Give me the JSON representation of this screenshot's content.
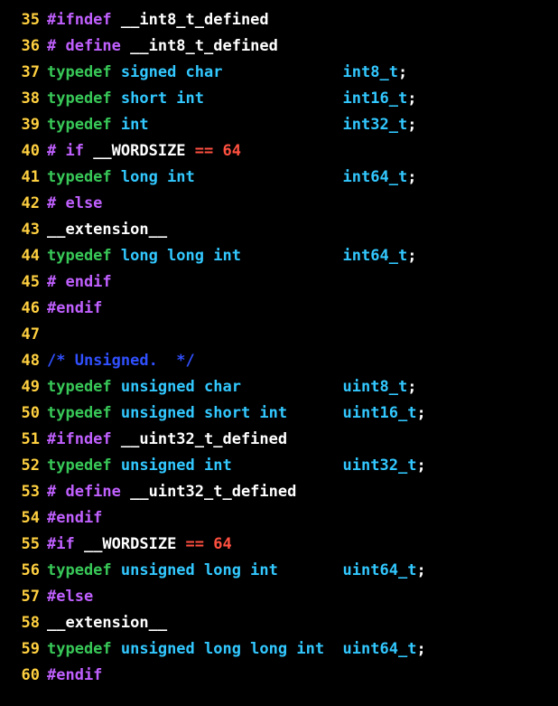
{
  "lines": [
    {
      "n": "35",
      "tokens": [
        {
          "c": "pp",
          "t": "#ifndef"
        },
        {
          "c": "id",
          "t": " __int8_t_defined"
        }
      ]
    },
    {
      "n": "36",
      "tokens": [
        {
          "c": "pp",
          "t": "# define"
        },
        {
          "c": "id",
          "t": " __int8_t_defined"
        }
      ]
    },
    {
      "n": "37",
      "tokens": [
        {
          "c": "kw",
          "t": "typedef"
        },
        {
          "c": "type",
          "t": " signed char"
        },
        {
          "c": "id",
          "t": "             "
        },
        {
          "c": "type",
          "t": "int8_t"
        },
        {
          "c": "punc",
          "t": ";"
        }
      ]
    },
    {
      "n": "38",
      "tokens": [
        {
          "c": "kw",
          "t": "typedef"
        },
        {
          "c": "type",
          "t": " short int"
        },
        {
          "c": "id",
          "t": "               "
        },
        {
          "c": "type",
          "t": "int16_t"
        },
        {
          "c": "punc",
          "t": ";"
        }
      ]
    },
    {
      "n": "39",
      "tokens": [
        {
          "c": "kw",
          "t": "typedef"
        },
        {
          "c": "type",
          "t": " int"
        },
        {
          "c": "id",
          "t": "                     "
        },
        {
          "c": "type",
          "t": "int32_t"
        },
        {
          "c": "punc",
          "t": ";"
        }
      ]
    },
    {
      "n": "40",
      "tokens": [
        {
          "c": "pp",
          "t": "# if"
        },
        {
          "c": "id",
          "t": " __WORDSIZE "
        },
        {
          "c": "op",
          "t": "=="
        },
        {
          "c": "id",
          "t": " "
        },
        {
          "c": "num",
          "t": "64"
        }
      ]
    },
    {
      "n": "41",
      "tokens": [
        {
          "c": "kw",
          "t": "typedef"
        },
        {
          "c": "type",
          "t": " long int"
        },
        {
          "c": "id",
          "t": "                "
        },
        {
          "c": "type",
          "t": "int64_t"
        },
        {
          "c": "punc",
          "t": ";"
        }
      ]
    },
    {
      "n": "42",
      "tokens": [
        {
          "c": "pp",
          "t": "# else"
        }
      ]
    },
    {
      "n": "43",
      "tokens": [
        {
          "c": "id",
          "t": "__extension__"
        }
      ]
    },
    {
      "n": "44",
      "tokens": [
        {
          "c": "kw",
          "t": "typedef"
        },
        {
          "c": "type",
          "t": " long long int"
        },
        {
          "c": "id",
          "t": "           "
        },
        {
          "c": "type",
          "t": "int64_t"
        },
        {
          "c": "punc",
          "t": ";"
        }
      ]
    },
    {
      "n": "45",
      "tokens": [
        {
          "c": "pp",
          "t": "# endif"
        }
      ]
    },
    {
      "n": "46",
      "tokens": [
        {
          "c": "pp",
          "t": "#endif"
        }
      ]
    },
    {
      "n": "47",
      "tokens": [
        {
          "c": "id",
          "t": ""
        }
      ]
    },
    {
      "n": "48",
      "tokens": [
        {
          "c": "cmt",
          "t": "/* Unsigned.  */"
        }
      ]
    },
    {
      "n": "49",
      "tokens": [
        {
          "c": "kw",
          "t": "typedef"
        },
        {
          "c": "type",
          "t": " unsigned char"
        },
        {
          "c": "id",
          "t": "           "
        },
        {
          "c": "type",
          "t": "uint8_t"
        },
        {
          "c": "punc",
          "t": ";"
        }
      ]
    },
    {
      "n": "50",
      "tokens": [
        {
          "c": "kw",
          "t": "typedef"
        },
        {
          "c": "type",
          "t": " unsigned short int"
        },
        {
          "c": "id",
          "t": "      "
        },
        {
          "c": "type",
          "t": "uint16_t"
        },
        {
          "c": "punc",
          "t": ";"
        }
      ]
    },
    {
      "n": "51",
      "tokens": [
        {
          "c": "pp",
          "t": "#ifndef"
        },
        {
          "c": "id",
          "t": " __uint32_t_defined"
        }
      ]
    },
    {
      "n": "52",
      "tokens": [
        {
          "c": "kw",
          "t": "typedef"
        },
        {
          "c": "type",
          "t": " unsigned int"
        },
        {
          "c": "id",
          "t": "            "
        },
        {
          "c": "type",
          "t": "uint32_t"
        },
        {
          "c": "punc",
          "t": ";"
        }
      ]
    },
    {
      "n": "53",
      "tokens": [
        {
          "c": "pp",
          "t": "# define"
        },
        {
          "c": "id",
          "t": " __uint32_t_defined"
        }
      ]
    },
    {
      "n": "54",
      "tokens": [
        {
          "c": "pp",
          "t": "#endif"
        }
      ]
    },
    {
      "n": "55",
      "tokens": [
        {
          "c": "pp",
          "t": "#if"
        },
        {
          "c": "id",
          "t": " __WORDSIZE "
        },
        {
          "c": "op",
          "t": "=="
        },
        {
          "c": "id",
          "t": " "
        },
        {
          "c": "num",
          "t": "64"
        }
      ]
    },
    {
      "n": "56",
      "tokens": [
        {
          "c": "kw",
          "t": "typedef"
        },
        {
          "c": "type",
          "t": " unsigned long int"
        },
        {
          "c": "id",
          "t": "       "
        },
        {
          "c": "type",
          "t": "uint64_t"
        },
        {
          "c": "punc",
          "t": ";"
        }
      ]
    },
    {
      "n": "57",
      "tokens": [
        {
          "c": "pp",
          "t": "#else"
        }
      ]
    },
    {
      "n": "58",
      "tokens": [
        {
          "c": "id",
          "t": "__extension__"
        }
      ]
    },
    {
      "n": "59",
      "tokens": [
        {
          "c": "kw",
          "t": "typedef"
        },
        {
          "c": "type",
          "t": " unsigned long long int"
        },
        {
          "c": "id",
          "t": "  "
        },
        {
          "c": "type",
          "t": "uint64_t"
        },
        {
          "c": "punc",
          "t": ";"
        }
      ]
    },
    {
      "n": "60",
      "tokens": [
        {
          "c": "pp",
          "t": "#endif"
        }
      ]
    }
  ]
}
